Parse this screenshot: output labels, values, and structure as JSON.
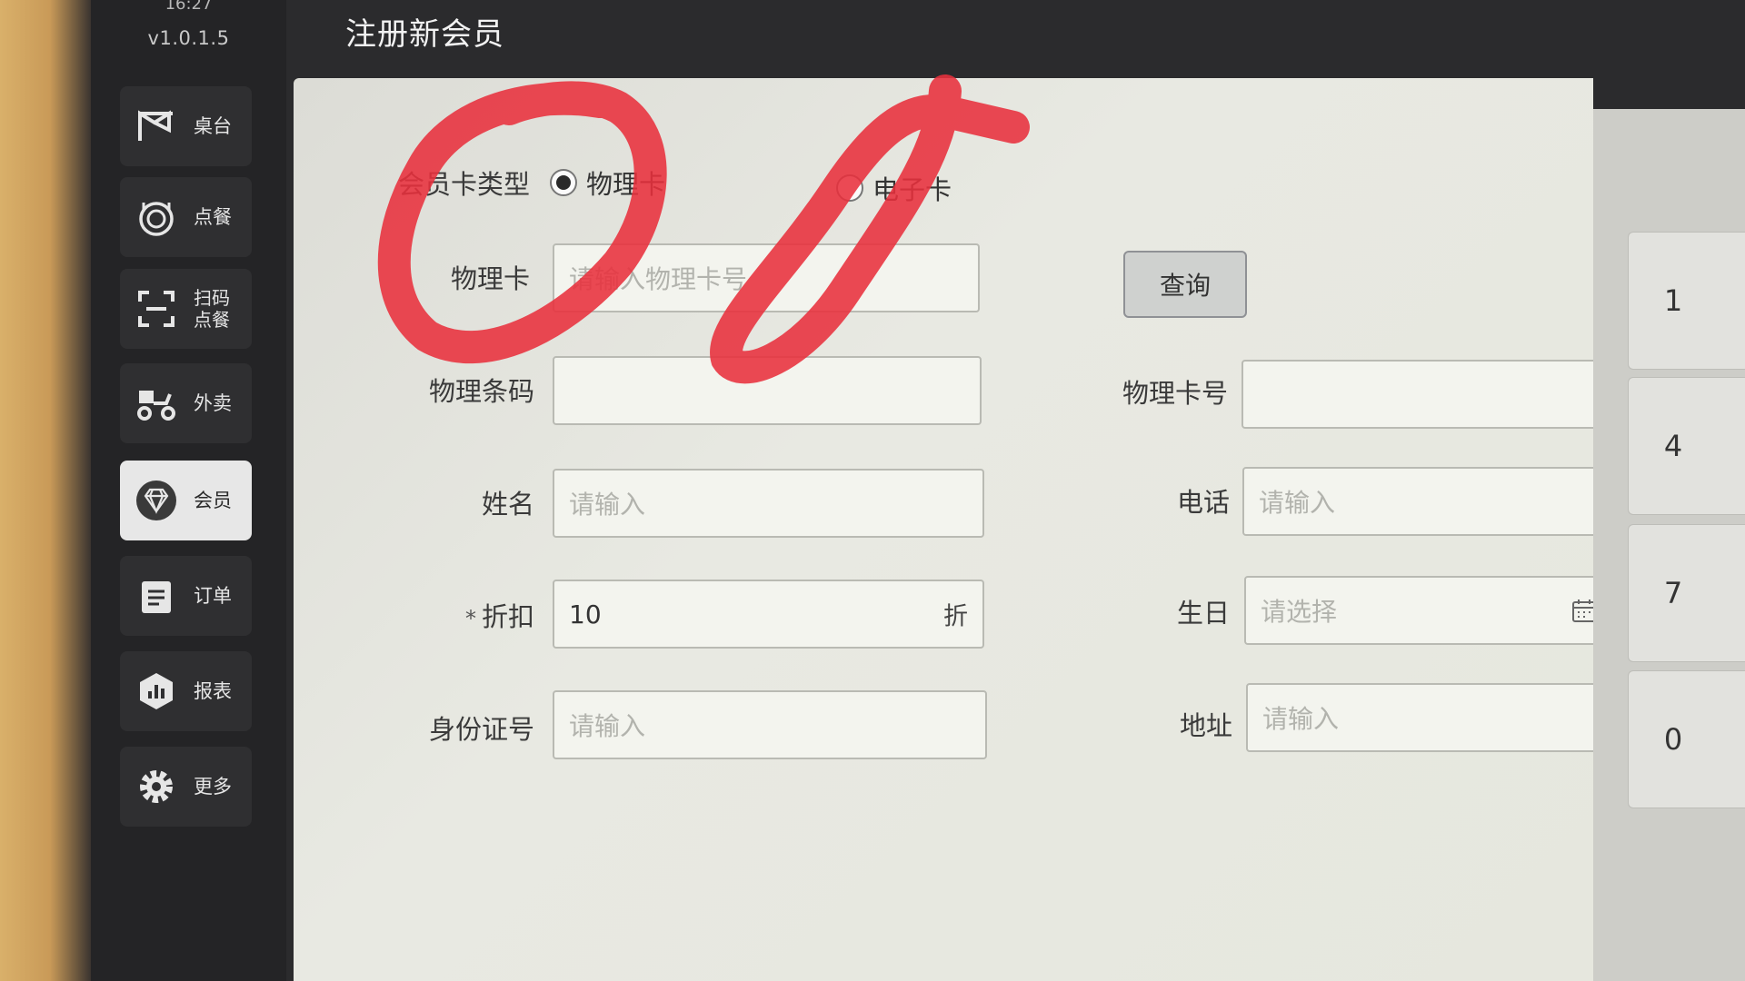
{
  "app": {
    "clock": "16:27",
    "version": "v1.0.1.5",
    "page_title": "注册新会员"
  },
  "sidebar": {
    "items": [
      {
        "label": "桌台",
        "icon": "table-flag-icon"
      },
      {
        "label": "点餐",
        "icon": "dish-icon"
      },
      {
        "label": "扫码\n点餐",
        "icon": "scan-icon"
      },
      {
        "label": "外卖",
        "icon": "delivery-scooter-icon"
      },
      {
        "label": "会员",
        "icon": "diamond-icon",
        "active": true
      },
      {
        "label": "订单",
        "icon": "clipboard-icon"
      },
      {
        "label": "报表",
        "icon": "chart-shield-icon"
      },
      {
        "label": "更多",
        "icon": "gear-icon"
      }
    ]
  },
  "form": {
    "card_type": {
      "label": "会员卡类型",
      "options": [
        {
          "label": "物理卡",
          "selected": true
        },
        {
          "label": "电子卡",
          "selected": false
        }
      ]
    },
    "physical_card": {
      "label": "物理卡",
      "placeholder": "请输入物理卡号"
    },
    "query_button": "查询",
    "physical_barcode": {
      "label": "物理条码",
      "value": ""
    },
    "physical_card_no": {
      "label": "物理卡号",
      "value": ""
    },
    "name": {
      "label": "姓名",
      "placeholder": "请输入"
    },
    "phone": {
      "label": "电话",
      "placeholder": "请输入"
    },
    "discount": {
      "label": "折扣",
      "required_mark": "*",
      "value": "10",
      "suffix": "折"
    },
    "birthday": {
      "label": "生日",
      "placeholder": "请选择"
    },
    "id_number": {
      "label": "身份证号",
      "placeholder": "请输入"
    },
    "address": {
      "label": "地址",
      "placeholder": "请输入"
    }
  },
  "keypad": {
    "keys": [
      "1",
      "4",
      "7",
      "0"
    ]
  },
  "colors": {
    "annotation": "#e8303c"
  }
}
